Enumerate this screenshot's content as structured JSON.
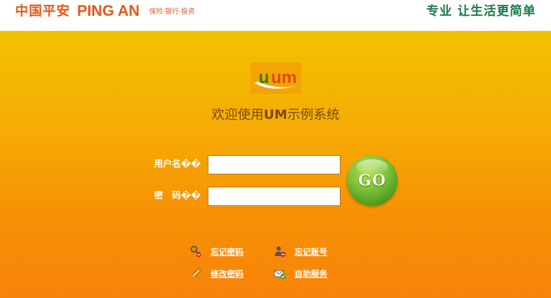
{
  "header": {
    "brand_cn": "中国平安",
    "brand_en": "PING AN",
    "brand_tagline": "保险·银行·投资",
    "slogan": "专业 让生活更简单"
  },
  "welcome": {
    "prefix": "欢迎使用",
    "highlight": "UM",
    "suffix": "示例系统"
  },
  "logo_text": "um",
  "form": {
    "username_label": "用户名��",
    "username_value": "",
    "password_label": "密　码��",
    "password_value": "",
    "submit_label": "GO"
  },
  "links": {
    "forgot_password": "忘记密码",
    "forgot_account": "忘记账号",
    "change_password": "修改密码",
    "self_service": "自助服务"
  },
  "colors": {
    "brand_orange": "#e5571b",
    "slogan_green": "#1b7a4a",
    "gradient_top": "#f2c200",
    "gradient_bottom": "#f8830a",
    "go_green": "#5ea82a"
  }
}
